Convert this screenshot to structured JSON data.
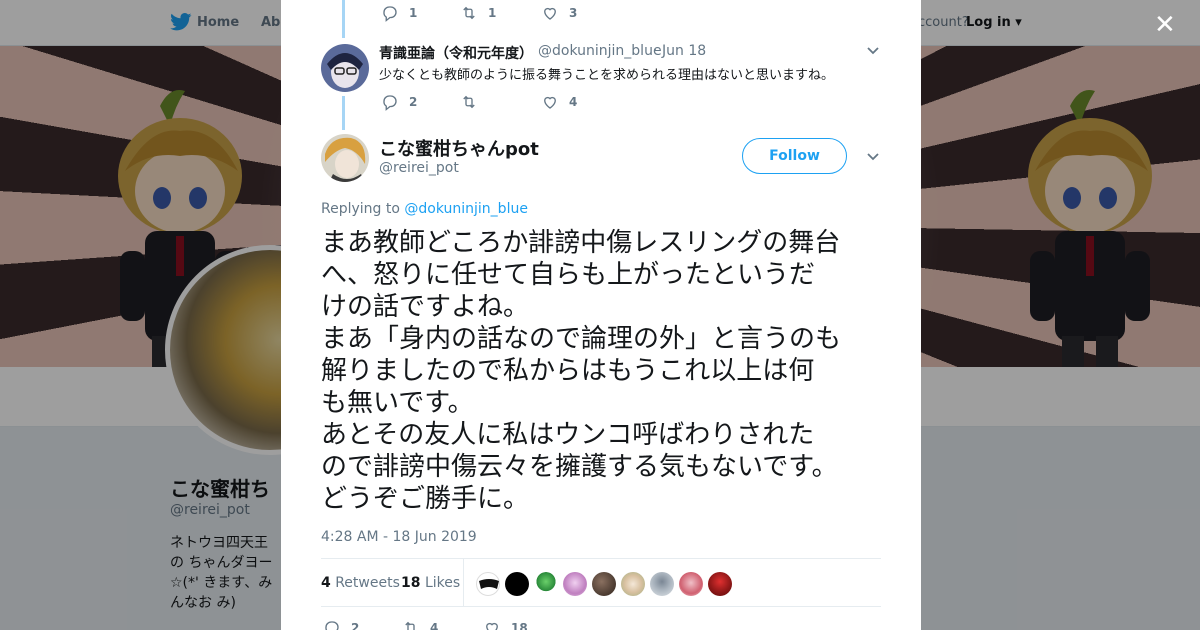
{
  "nav": {
    "home_label": "Home",
    "about_label": "Abo",
    "account_prompt": "ccount?",
    "login_label": "Log in"
  },
  "profile_bg": {
    "name": "こな蜜柑ち",
    "handle": "@reirei_pot",
    "bio": "ネトウヨ四天王の ちゃんダヨー☆(*' きます、みんなお み)"
  },
  "reply": {
    "author_name": "青識亜論（令和元年度）",
    "author_handle": "@dokuninjin_blue",
    "separator": "·",
    "date": "Jun 18",
    "text": "少なくとも教師のように振る舞うことを求められる理由はないと思いますね。",
    "reply_count": "2",
    "retweet_count": "",
    "like_count": "4"
  },
  "prev_actions": {
    "reply_count": "1",
    "retweet_count": "1",
    "like_count": "3"
  },
  "main_tweet": {
    "author_name": "こな蜜柑ちゃんpot",
    "author_handle": "@reirei_pot",
    "follow_label": "Follow",
    "replying_prefix": "Replying to",
    "replying_to": "@dokuninjin_blue",
    "lines": [
      "まあ教師どころか誹謗中傷レスリングの舞台",
      "へ、怒りに任せて自らも上がったというだ",
      "けの話ですよね。",
      "まあ「身内の話なので論理の外」と言うのも",
      "解りましたので私からはもうこれ以上は何",
      "も無いです。",
      "あとその友人に私はウンコ呼ばわりされた",
      "ので誹謗中傷云々を擁護する気もないです。",
      "どうぞご勝手に。"
    ],
    "timestamp": "4:28 AM - 18 Jun 2019",
    "retweets_count": "4",
    "retweets_label": "Retweets",
    "likes_count": "18",
    "likes_label": "Likes",
    "footer_reply_count": "2",
    "footer_retweet_count": "4",
    "footer_like_count": "18"
  },
  "colors": {
    "accent": "#1da1f2",
    "thread_line": "#a6d5f5",
    "muted": "#657786",
    "text": "#14171a"
  }
}
